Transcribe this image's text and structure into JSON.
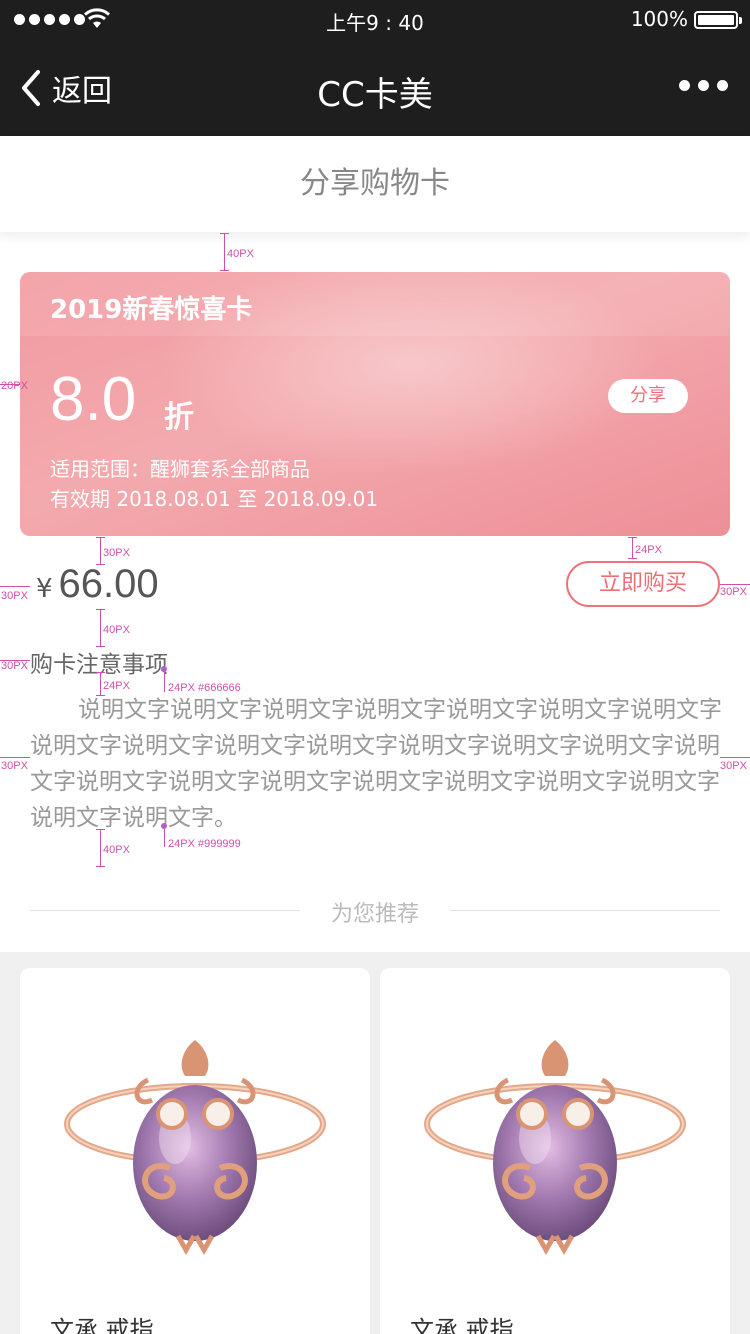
{
  "status_bar": {
    "time": "上午9 : 40",
    "battery": "100%"
  },
  "nav": {
    "back_label": "返回",
    "title": "CC卡美"
  },
  "subheader": {
    "title": "分享购物卡"
  },
  "card": {
    "title": "2019新春惊喜卡",
    "discount": "8.0",
    "discount_unit": "折",
    "scope": "适用范围：醒狮套系全部商品",
    "validity": "有效期 2018.08.01 至 2018.09.01",
    "share_label": "分享"
  },
  "price": {
    "currency": "¥",
    "amount": "66.00"
  },
  "buy_label": "立即购买",
  "notes": {
    "title": "购卡注意事项",
    "body": "说明文字说明文字说明文字说明文字说明文字说明文字说明文字说明文字说明文字说明文字说明文字说明文字说明文字说明文字说明文字说明文字说明文字说明文字说明文字说明文字说明文字说明文字说明文字说明文字。"
  },
  "annotations": {
    "a1": "40PX",
    "a2": "20PX",
    "a3": "30PX",
    "a4": "24PX",
    "a5": "30PX",
    "a6": "30PX",
    "a7": "40PX",
    "a8": "30PX",
    "a9": "24PX",
    "a10": "24PX #666666",
    "a11": "30PX",
    "a12": "30PX",
    "a13": "24PX #999999",
    "a14": "40PX"
  },
  "recommend": {
    "label": "为您推荐"
  },
  "products": [
    {
      "name": "文承 戒指",
      "icon": "ring-image"
    },
    {
      "name": "文承 戒指",
      "icon": "ring-image"
    }
  ],
  "colors": {
    "nav_bg": "#1e1e1e",
    "accent": "#ee6f77",
    "card": "#f29aa0",
    "annotation": "#d04fa8"
  }
}
